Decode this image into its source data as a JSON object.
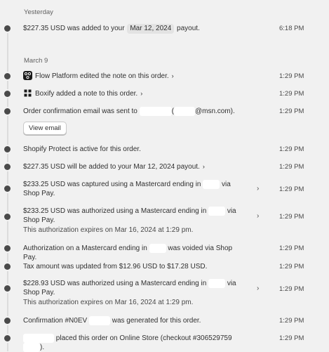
{
  "groups": {
    "yesterday_label": "Yesterday",
    "march9_label": "March 9"
  },
  "events": {
    "e1": {
      "pre": "$227.35 USD was added to your",
      "pill": "Mar 12, 2024",
      "post": "payout.",
      "time": "6:18 PM"
    },
    "e2": {
      "app": "Flow Platform",
      "text": "edited the note on this order.",
      "time": "1:29 PM"
    },
    "e3": {
      "app": "Boxify",
      "text": "added a note to this order.",
      "time": "1:29 PM"
    },
    "e4": {
      "pre": "Order confirmation email was sent to",
      "mid": "(",
      "post": "@msn.com).",
      "button": "View email",
      "time": "1:29 PM"
    },
    "e5": {
      "text": "Shopify Protect is active for this order.",
      "time": "1:29 PM"
    },
    "e6": {
      "text": "$227.35 USD will be added to your Mar 12, 2024 payout.",
      "time": "1:29 PM"
    },
    "e7": {
      "pre": "$233.25 USD was captured using a Mastercard ending in",
      "post": "via Shop Pay.",
      "time": "1:29 PM"
    },
    "e8": {
      "pre": "$233.25 USD was authorized using a Mastercard ending in",
      "post": "via Shop Pay.",
      "sub": "This authorization expires on Mar 16, 2024 at 1:29 pm.",
      "time": "1:29 PM"
    },
    "e9": {
      "pre": "Authorization on a Mastercard ending in",
      "post": "was voided via Shop Pay.",
      "time": "1:29 PM"
    },
    "e10": {
      "text": "Tax amount was updated from $12.96 USD to $17.28 USD.",
      "time": "1:29 PM"
    },
    "e11": {
      "pre": "$228.93 USD was authorized using a Mastercard ending in",
      "post": "via Shop Pay.",
      "sub": "This authorization expires on Mar 16, 2024 at 1:29 pm.",
      "time": "1:29 PM"
    },
    "e12": {
      "pre": "Confirmation #N0EV",
      "post": "was generated for this order.",
      "time": "1:29 PM"
    },
    "e13": {
      "pre": "placed this order on Online Store (checkout #306529759",
      "post": ").",
      "time": "1:29 PM"
    }
  },
  "icons": {
    "chevron": "chevron-right-icon",
    "flow": "flow-app-icon",
    "boxify": "boxify-app-icon"
  }
}
